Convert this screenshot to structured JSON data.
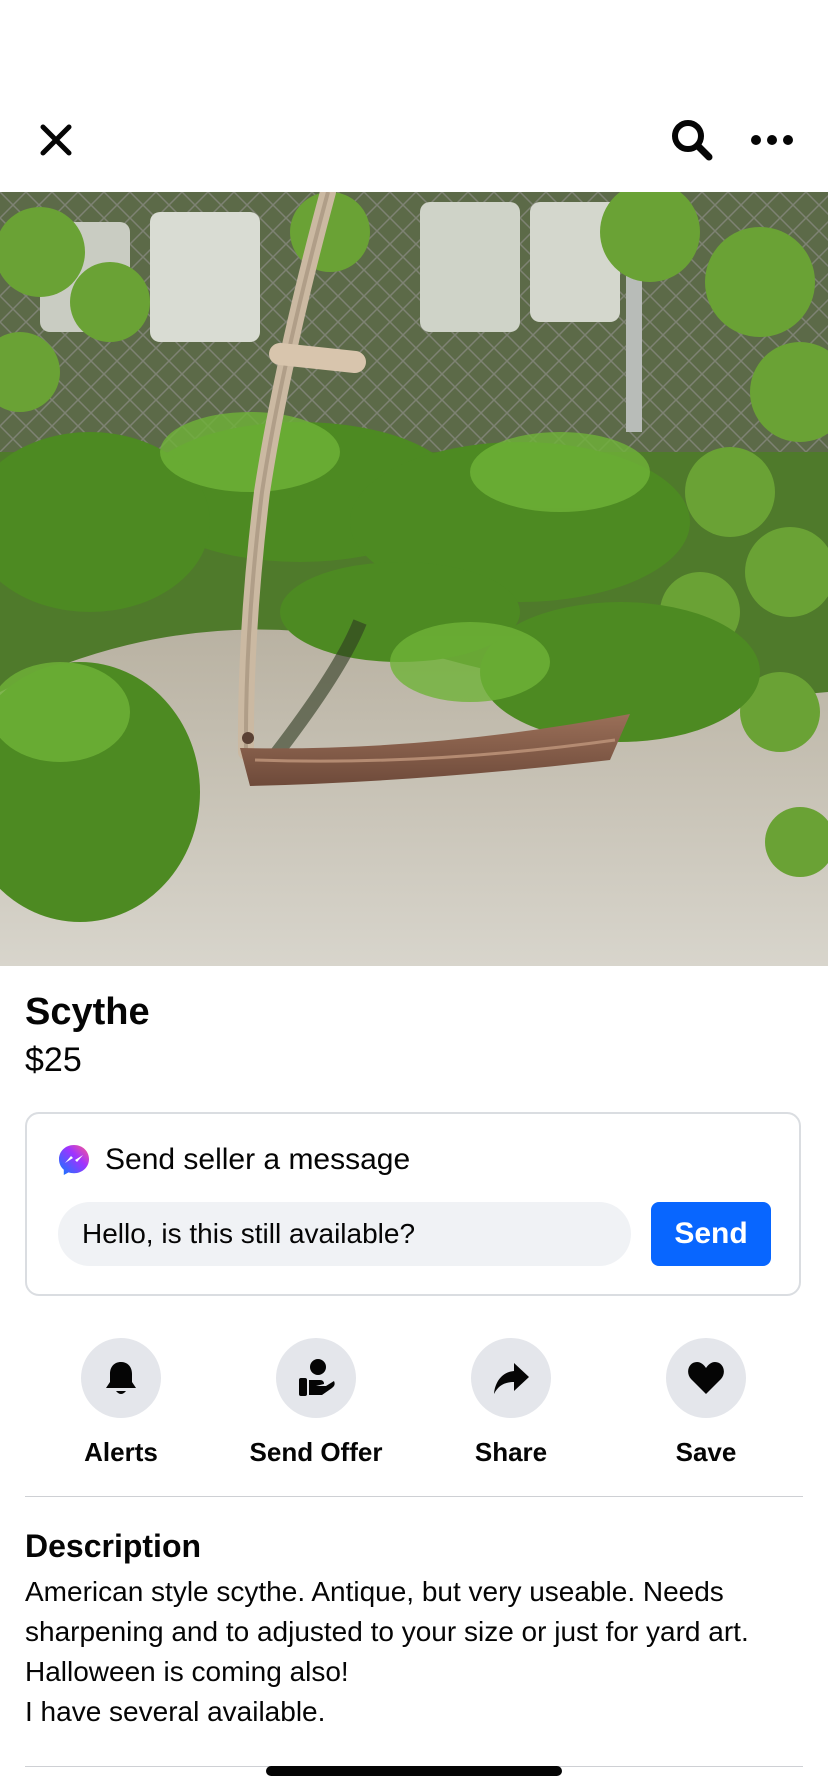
{
  "listing": {
    "title": "Scythe",
    "price": "$25"
  },
  "message": {
    "header": "Send seller a message",
    "input_value": "Hello, is this still available?",
    "send_label": "Send"
  },
  "actions": [
    {
      "label": "Alerts",
      "icon": "bell-icon"
    },
    {
      "label": "Send Offer",
      "icon": "offer-icon"
    },
    {
      "label": "Share",
      "icon": "share-icon"
    },
    {
      "label": "Save",
      "icon": "heart-icon"
    }
  ],
  "description": {
    "heading": "Description",
    "lines": [
      "American style scythe.  Antique, but very useable.  Needs",
      "sharpening and to adjusted to your size or just for yard art.",
      "Halloween is coming also!",
      "I have several available."
    ]
  },
  "icons": {
    "close": "close-icon",
    "search": "search-icon",
    "more": "more-icon",
    "messenger": "messenger-icon"
  },
  "colors": {
    "accent": "#0866ff",
    "button_bg": "#e4e6eb",
    "input_bg": "#f0f2f5",
    "text": "#050505"
  }
}
